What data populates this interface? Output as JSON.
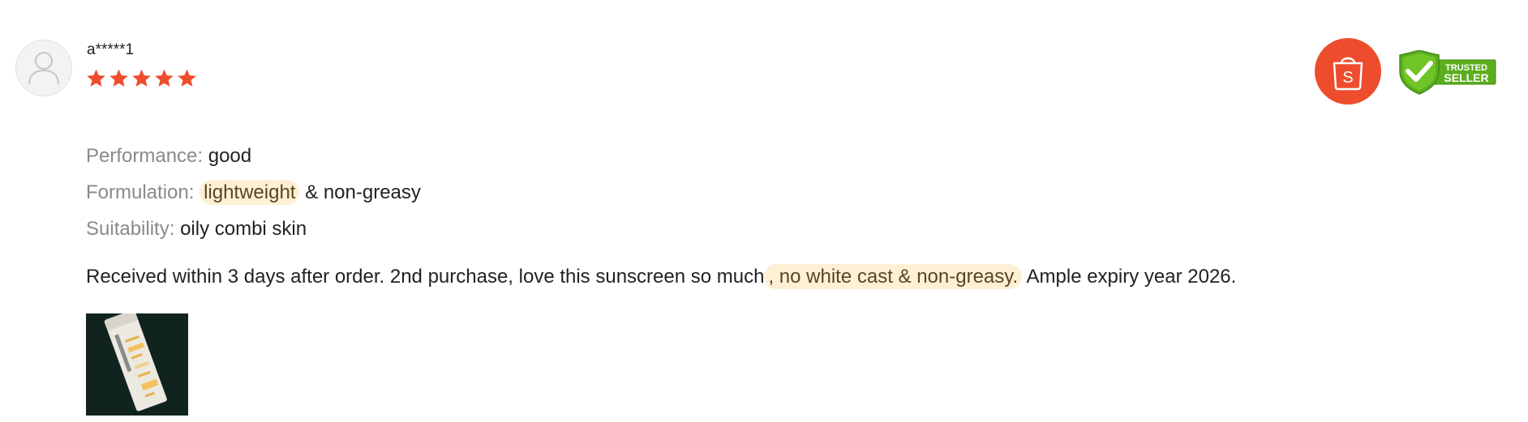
{
  "review": {
    "username": "a*****1",
    "rating": 5,
    "rating_max": 5,
    "star_color": "#ee4d2d",
    "attributes": [
      {
        "label": "Performance:",
        "value": "good"
      },
      {
        "label": "Formulation:",
        "highlight": "lightweight",
        "value": " & non-greasy"
      },
      {
        "label": "Suitability:",
        "value": "oily combi skin"
      }
    ],
    "text_before": "Received within 3 days after order. 2nd purchase, love this sunscreen so much",
    "text_highlight": ", no white cast & non-greasy.",
    "text_after": " Ample expiry year 2026.",
    "photo_icon": "sunscreen-tube-photo"
  },
  "badges": {
    "shop_icon": "shopping-bag-icon",
    "shop_letter": "S",
    "shop_color": "#ee4d2d",
    "trusted_line1": "TRUSTED",
    "trusted_line2": "SELLER",
    "trusted_color": "#5cae1f"
  },
  "avatar_icon": "user-icon"
}
